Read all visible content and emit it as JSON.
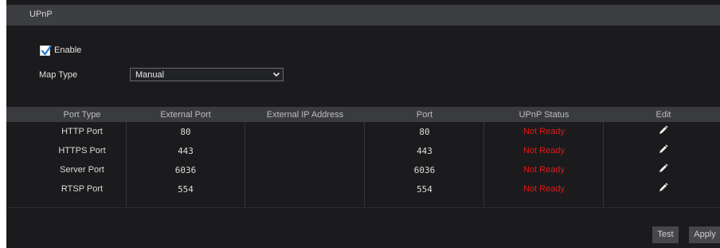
{
  "title": "UPnP",
  "enable": {
    "label": "Enable",
    "checked": true
  },
  "map_type": {
    "label": "Map Type",
    "value": "Manual"
  },
  "table": {
    "headers": [
      "Port Type",
      "External Port",
      "External IP Address",
      "Port",
      "UPnP Status",
      "Edit"
    ],
    "rows": [
      {
        "port_type": "HTTP Port",
        "external_port": "80",
        "external_ip": "",
        "port": "80",
        "status": "Not Ready"
      },
      {
        "port_type": "HTTPS Port",
        "external_port": "443",
        "external_ip": "",
        "port": "443",
        "status": "Not Ready"
      },
      {
        "port_type": "Server Port",
        "external_port": "6036",
        "external_ip": "",
        "port": "6036",
        "status": "Not Ready"
      },
      {
        "port_type": "RTSP Port",
        "external_port": "554",
        "external_ip": "",
        "port": "554",
        "status": "Not Ready"
      }
    ]
  },
  "buttons": {
    "test": "Test",
    "apply": "Apply"
  },
  "colors": {
    "status_not_ready": "#e01818",
    "checkbox_accent": "#1f7fd1"
  }
}
